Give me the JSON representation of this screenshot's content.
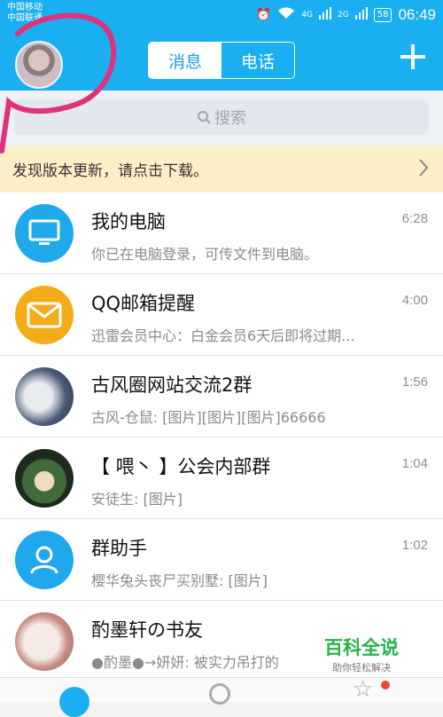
{
  "statusbar": {
    "carrier1": "中国移动",
    "carrier2": "中国联通",
    "net_4g": "4G",
    "net_2g": "2G",
    "battery": "58",
    "time": "06:49"
  },
  "header": {
    "tab_messages": "消息",
    "tab_calls": "电话"
  },
  "search": {
    "placeholder": "搜索"
  },
  "notice": {
    "text": "发现版本更新，请点击下载。"
  },
  "chats": [
    {
      "title": "我的电脑",
      "subtitle": "你已在电脑登录，可传文件到电脑。",
      "time": "6:28",
      "icon": "monitor-icon"
    },
    {
      "title": "QQ邮箱提醒",
      "subtitle": "迅雷会员中心：白金会员6天后即将过期...",
      "time": "4:00",
      "icon": "mail-icon"
    },
    {
      "title": "古风圈网站交流2群",
      "subtitle": "古风-仓鼠: [图片][图片][图片]66666",
      "time": "1:56",
      "icon": "group-avatar"
    },
    {
      "title": "【 喂丶 】公会内部群",
      "subtitle": "安徒生: [图片]",
      "time": "1:04",
      "icon": "group-avatar"
    },
    {
      "title": "群助手",
      "subtitle": "樱华兔头丧尸买别墅: [图片]",
      "time": "1:02",
      "icon": "group-helper-icon"
    },
    {
      "title": "酌墨轩の书友",
      "subtitle": "●酌墨●→妍妍: 被实力吊打的",
      "time": "",
      "icon": "group-avatar"
    }
  ],
  "watermark": {
    "main": "百科全说",
    "sub": "助你轻松解决"
  },
  "colors": {
    "accent": "#19aff0",
    "notice_bg": "#fbefc7",
    "annotation": "#e0317e"
  }
}
